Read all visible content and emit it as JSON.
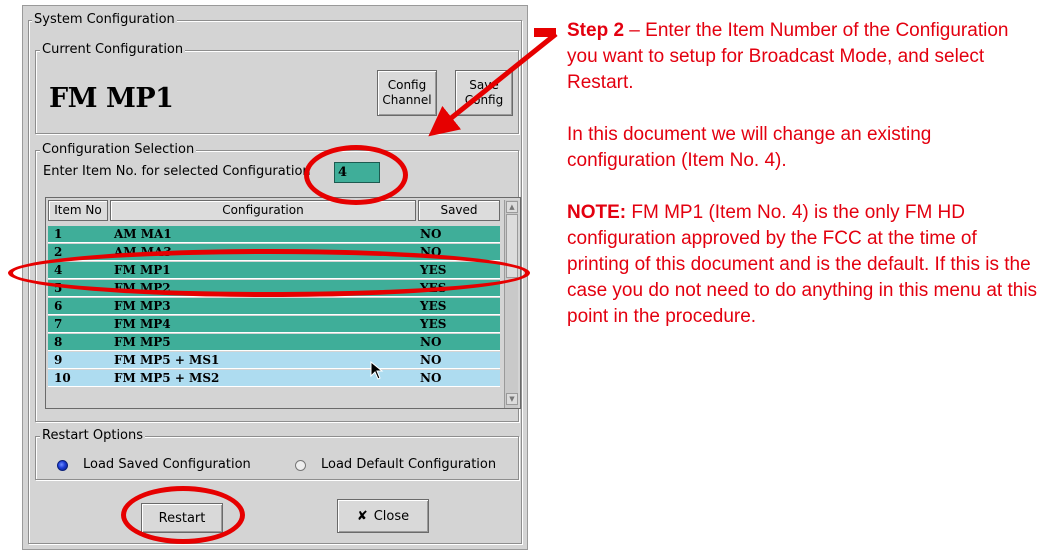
{
  "dialog": {
    "title": "System Configuration",
    "current": {
      "legend": "Current Configuration",
      "name": "FM MP1",
      "config_channel": [
        "Config",
        "Channel"
      ],
      "save_config": [
        "Save",
        "Config"
      ]
    },
    "selection": {
      "legend": "Configuration Selection",
      "enter_label": "Enter Item No. for selected Configuration",
      "item_value": "4",
      "columns": [
        "Item No",
        "Configuration",
        "Saved"
      ],
      "rows": [
        {
          "no": "1",
          "config": "AM MA1",
          "saved": "NO",
          "color": "#3fae99"
        },
        {
          "no": "2",
          "config": "AM MA3",
          "saved": "NO",
          "color": "#3fae99"
        },
        {
          "no": "4",
          "config": "FM MP1",
          "saved": "YES",
          "color": "#3fae99"
        },
        {
          "no": "5",
          "config": "FM MP2",
          "saved": "YES",
          "color": "#3fae99"
        },
        {
          "no": "6",
          "config": "FM MP3",
          "saved": "YES",
          "color": "#3fae99"
        },
        {
          "no": "7",
          "config": "FM MP4",
          "saved": "YES",
          "color": "#3fae99"
        },
        {
          "no": "8",
          "config": "FM MP5",
          "saved": "NO",
          "color": "#3fae99"
        },
        {
          "no": "9",
          "config": "FM MP5 + MS1",
          "saved": "NO",
          "color": "#aedcf0"
        },
        {
          "no": "10",
          "config": "FM MP5 + MS2",
          "saved": "NO",
          "color": "#aedcf0"
        }
      ]
    },
    "restart_options": {
      "legend": "Restart Options",
      "load_saved": "Load Saved Configuration",
      "load_default": "Load Default Configuration",
      "selected": "load_saved"
    },
    "buttons": {
      "restart": "Restart",
      "close": "Close",
      "close_glyph": "✘"
    }
  },
  "annotation_color": "#e60000",
  "notes": {
    "step_label": "Step 2",
    "step_text": " – Enter the Item Number of the Configuration you want to setup for Broadcast Mode, and select Restart.",
    "para2": "In this document we will change an existing configuration (Item No. 4).",
    "note_label": "NOTE:",
    "note_text": " FM MP1 (Item No. 4) is the only FM HD configuration approved by the FCC at the time of printing of this document and is the default.  If this is the case you do not need to do anything in this menu at this point in the procedure."
  }
}
